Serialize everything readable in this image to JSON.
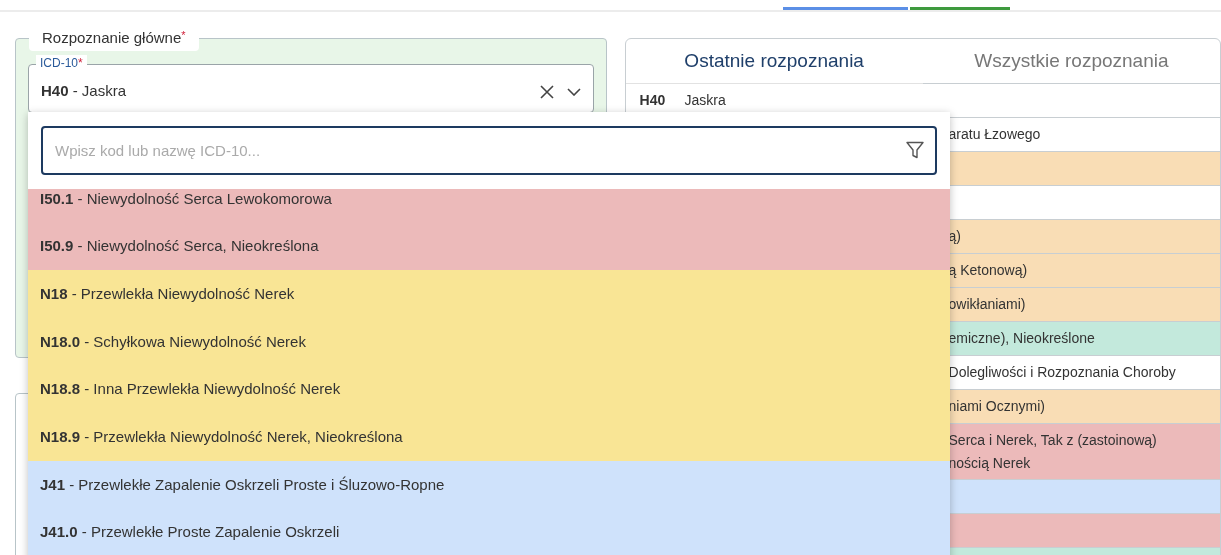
{
  "main_diagnosis": {
    "legend": "Rozpoznanie główne",
    "required_mark": "*",
    "field": {
      "label": "ICD-10",
      "required_mark": "*",
      "code": "H40",
      "name": "- Jaskra"
    }
  },
  "dropdown": {
    "search": {
      "placeholder": "Wpisz kod lub nazwę ICD-10..."
    },
    "options": [
      {
        "code": "I50.1",
        "name": "- Niewydolność Serca Lewokomorowa",
        "color": "#ecbaba"
      },
      {
        "code": "I50.9",
        "name": "- Niewydolność Serca, Nieokreślona",
        "color": "#ecbaba"
      },
      {
        "code": "N18",
        "name": "- Przewlekła Niewydolność Nerek",
        "color": "#f9e595"
      },
      {
        "code": "N18.0",
        "name": "- Schyłkowa Niewydolność Nerek",
        "color": "#f9e595"
      },
      {
        "code": "N18.8",
        "name": "- Inna Przewlekła Niewydolność Nerek",
        "color": "#f9e595"
      },
      {
        "code": "N18.9",
        "name": "- Przewlekła Niewydolność Nerek, Nieokreślona",
        "color": "#f9e595"
      },
      {
        "code": "J41",
        "name": "- Przewlekłe Zapalenie Oskrzeli Proste i Śluzowo-Ropne",
        "color": "#cfe2fb"
      },
      {
        "code": "J41.0",
        "name": "- Przewlekłe Proste Zapalenie Oskrzeli",
        "color": "#cfe2fb"
      }
    ]
  },
  "diagnoses_panel": {
    "tabs": [
      {
        "label": "Ostatnie rozpoznania",
        "selected": true
      },
      {
        "label": "Wszystkie rozpoznania",
        "selected": false
      }
    ],
    "rows": [
      {
        "code": "H40",
        "name": "Jaskra",
        "color": "#ffffff"
      },
      {
        "name": "aratu Łzowego",
        "color": "#ffffff"
      },
      {
        "color": "#f9ddb5"
      },
      {
        "color": "#ffffff"
      },
      {
        "name": "ą)",
        "color": "#f9ddb5"
      },
      {
        "name": "ą Ketonową)",
        "color": "#f9ddb5"
      },
      {
        "name": "owikłaniami)",
        "color": "#f9ddb5"
      },
      {
        "name": "emiczne), Nieokreślone",
        "color": "#c3e9dc"
      },
      {
        "name": "Dolegliwości i Rozpoznania Choroby",
        "color": "#ffffff"
      },
      {
        "name": "niami Ocznymi)",
        "color": "#f9ddb5"
      },
      {
        "name": "Serca i Nerek, Tak z (zastoinową)\nnością Nerek",
        "color": "#ecbaba"
      },
      {
        "color": "#cfe2fb"
      },
      {
        "color": "#ecbaba"
      },
      {
        "color": "#c3e9dc"
      }
    ]
  }
}
